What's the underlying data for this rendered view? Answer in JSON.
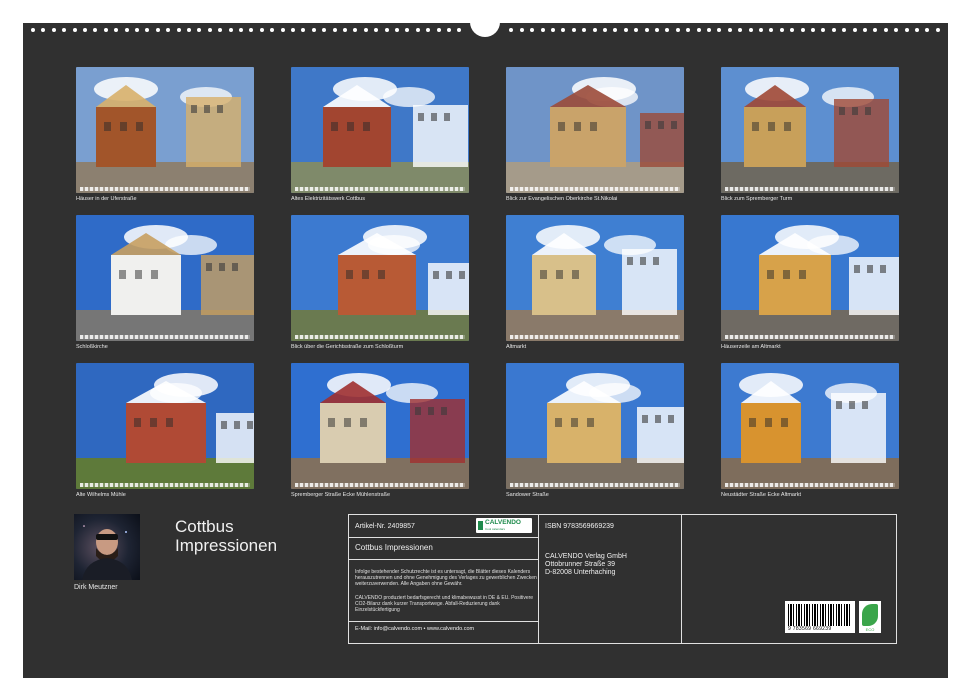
{
  "photos": [
    {
      "caption": "Häuser in der Uferstraße",
      "palette": {
        "sky": "#7a9fd0",
        "main": "#a2552a",
        "accent": "#d8b06a",
        "ground": "#8c8070"
      }
    },
    {
      "caption": "Altes Elektrizitätswerk Cottbus",
      "palette": {
        "sky": "#3f78c8",
        "main": "#a24530",
        "accent": "#ffffff",
        "ground": "#7f8a6a"
      }
    },
    {
      "caption": "Blick zur Evangelischen Oberkirche St.Nikolai",
      "palette": {
        "sky": "#6f94c8",
        "main": "#c9a36a",
        "accent": "#9b4a38",
        "ground": "#a59b8a"
      }
    },
    {
      "caption": "Blick zum Spremberger Turm",
      "palette": {
        "sky": "#5d8fd0",
        "main": "#c8a05a",
        "accent": "#a04835",
        "ground": "#6d6a62"
      }
    },
    {
      "caption": "Schloßkirche",
      "palette": {
        "sky": "#2f6bc8",
        "main": "#f0f0ee",
        "accent": "#c8a060",
        "ground": "#767676"
      }
    },
    {
      "caption": "Blick über die Gerichtsstraße zum Schloßturm",
      "palette": {
        "sky": "#3c7ad0",
        "main": "#b85a35",
        "accent": "#ffffff",
        "ground": "#6a7a50"
      }
    },
    {
      "caption": "Altmarkt",
      "palette": {
        "sky": "#3f7fd2",
        "main": "#d8c08a",
        "accent": "#ffffff",
        "ground": "#8a7a6a"
      }
    },
    {
      "caption": "Häuserzeile am Altmarkt",
      "palette": {
        "sky": "#3878d0",
        "main": "#d7a24a",
        "accent": "#ffffff",
        "ground": "#6f6a63"
      }
    },
    {
      "caption": "Alte Wilhelms Mühle",
      "palette": {
        "sky": "#2f68c0",
        "main": "#b04a35",
        "accent": "#ffffff",
        "ground": "#5e7a3a"
      }
    },
    {
      "caption": "Spremberger Straße Ecke Mühlenstraße",
      "palette": {
        "sky": "#2f6fd0",
        "main": "#d9ccb0",
        "accent": "#a03030",
        "ground": "#807060"
      }
    },
    {
      "caption": "Sandower Straße",
      "palette": {
        "sky": "#3a78d0",
        "main": "#d8b26a",
        "accent": "#ffffff",
        "ground": "#7a6f62"
      }
    },
    {
      "caption": "Neustädter Straße Ecke Altmarkt",
      "palette": {
        "sky": "#3d7ad0",
        "main": "#d8932f",
        "accent": "#ffffff",
        "ground": "#7e6d5c"
      }
    }
  ],
  "author": {
    "name": "Dirk Meutzner"
  },
  "title": {
    "line1": "Cottbus",
    "line2": "Impressionen"
  },
  "info": {
    "article": "Artikel-Nr. 2409857",
    "product_title": "Cottbus Impressionen",
    "legal": "Infolge bestehender Schutzrechte ist es untersagt, die Blätter dieses Kalenders herauszutrennen und ohne Genehmigung des Verlages zu gewerblichen Zwecken weiterzuverwenden. Alle Angaben ohne Gewähr.",
    "eco_note": "CALVENDO produziert bedarfsgerecht und klimabewusst in DE & EU. Positivere CO2-Bilanz dank kurzer Transportwege. Abfall-Reduzierung dank Einzelstückfertigung",
    "contact": "E-Mail: info@calvendo.com • www.calvendo.com",
    "isbn": "ISBN 9783569669239",
    "publisher_name": "CALVENDO Verlag GmbH",
    "publisher_street": "Ottobrunner Straße 39",
    "publisher_city": "D-82008 Unterhaching",
    "logo_word": "CALVENDO",
    "logo_sub": "Cool calendars",
    "barcode_number": "9 783569 669239",
    "eco_label": "ECO"
  },
  "colors": {
    "page": "#303030",
    "text": "#f0f0f0",
    "brand": "#1f8b4c"
  }
}
